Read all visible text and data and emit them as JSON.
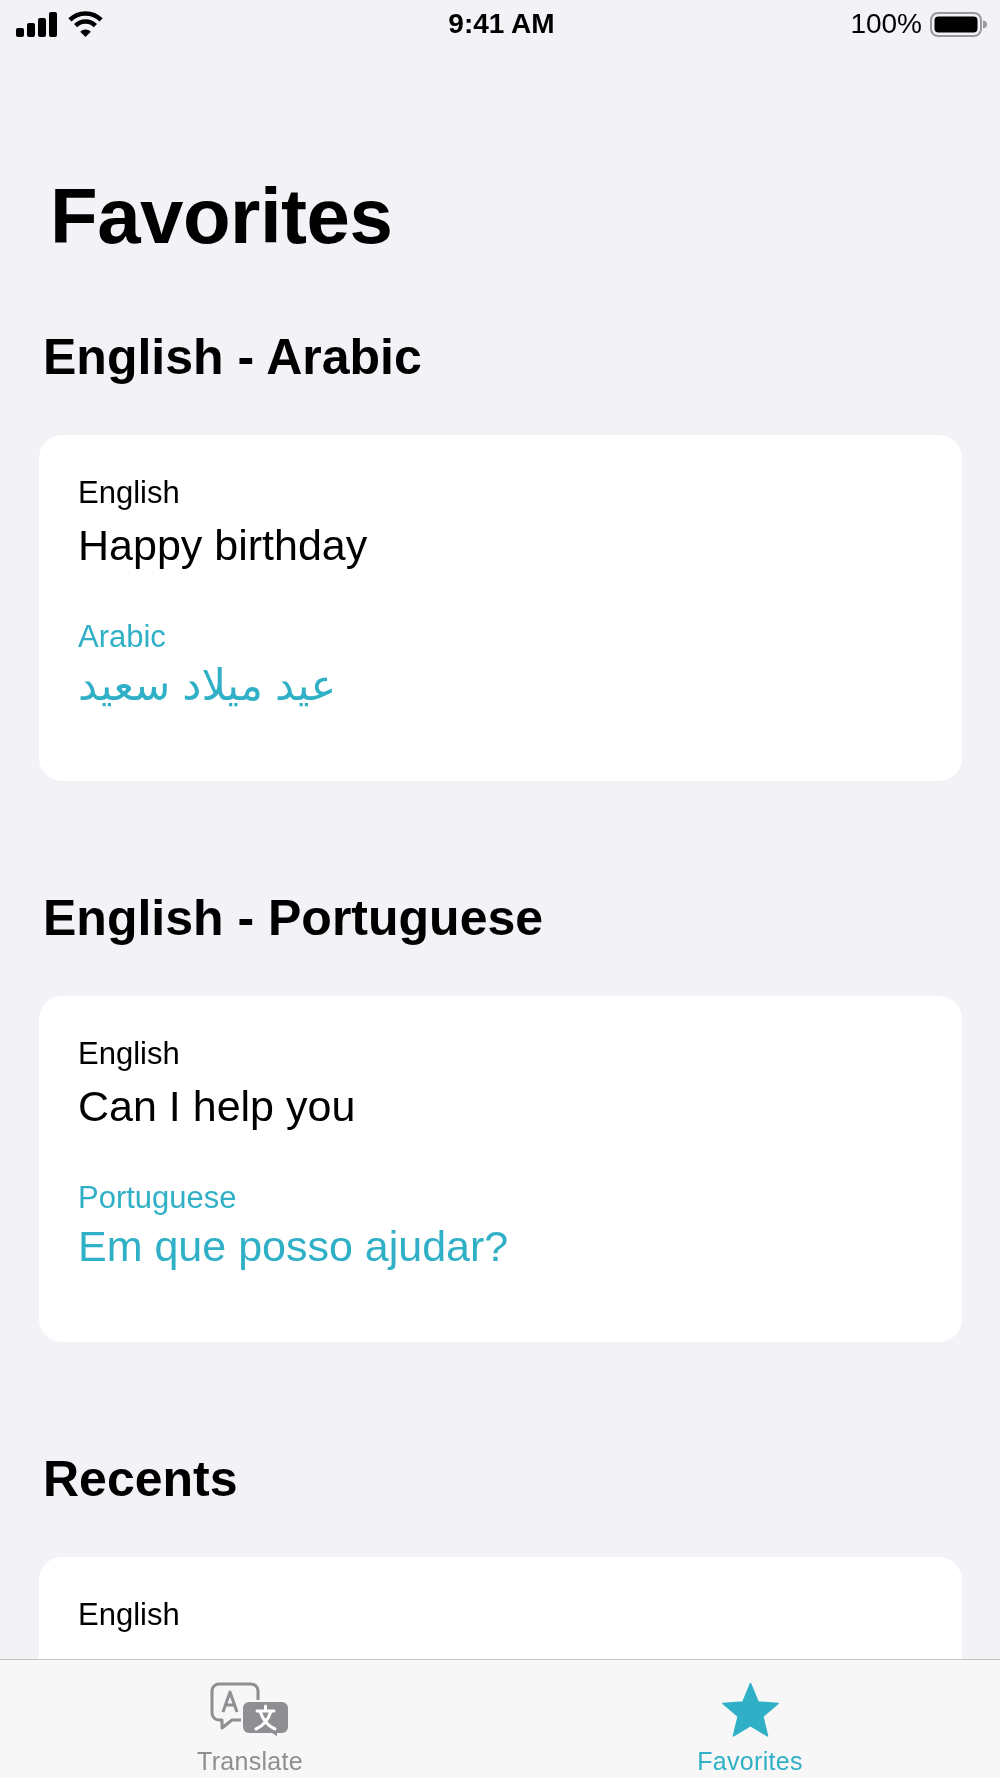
{
  "status_bar": {
    "time": "9:41 AM",
    "battery": "100%"
  },
  "title": "Favorites",
  "sections": [
    {
      "heading": "English - Arabic",
      "cards": [
        {
          "source_language": "English",
          "source_text": "Happy birthday",
          "target_language": "Arabic",
          "target_text": "عيد ميلاد سعيد"
        }
      ]
    },
    {
      "heading": "English - Portuguese",
      "cards": [
        {
          "source_language": "English",
          "source_text": "Can I help you",
          "target_language": "Portuguese",
          "target_text": "Em que posso ajudar?"
        }
      ]
    },
    {
      "heading": "Recents",
      "cards": [
        {
          "source_language": "English"
        }
      ]
    }
  ],
  "tab_bar": {
    "tabs": [
      {
        "label": "Translate",
        "kind": "translate",
        "selected": false
      },
      {
        "label": "Favorites",
        "kind": "star",
        "selected": true
      }
    ]
  }
}
